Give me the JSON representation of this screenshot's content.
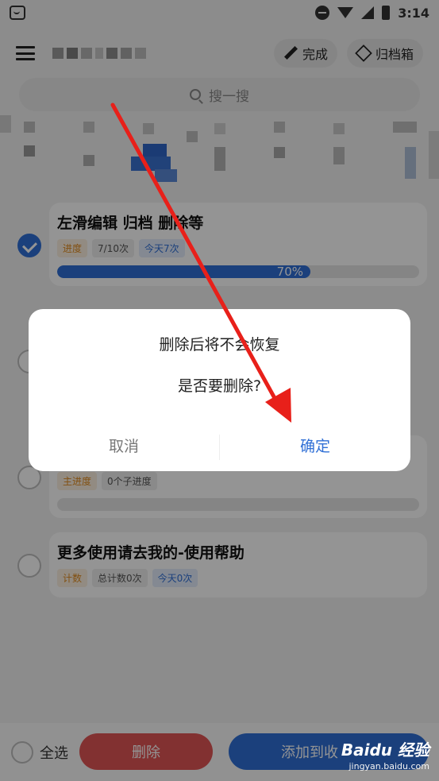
{
  "status_bar": {
    "time": "3:14"
  },
  "header": {
    "done_label": "完成",
    "archive_label": "归档箱"
  },
  "search": {
    "placeholder": "搜一搜"
  },
  "tasks": [
    {
      "title": "左滑编辑 归档 删除等",
      "checked": true,
      "tags": [
        "进度",
        "7/10次",
        "今天7次"
      ],
      "progress_percent": 70,
      "progress_label": "70%"
    },
    {
      "title": "",
      "checked": false,
      "tags": [
        "主进度",
        "0个子进度"
      ],
      "progress_percent": 0
    },
    {
      "title": "更多使用请去我的-使用帮助",
      "checked": false,
      "tags": [
        "计数",
        "总计数0次",
        "今天0次"
      ]
    }
  ],
  "bottom_bar": {
    "select_all_label": "全选",
    "delete_label": "删除",
    "add_label": "添加到收"
  },
  "dialog": {
    "message_line1": "删除后将不会恢复",
    "message_line2": "是否要删除?",
    "cancel_label": "取消",
    "confirm_label": "确定"
  },
  "watermark": {
    "brand": "Baidu 经验",
    "url": "jingyan.baidu.com"
  },
  "colors": {
    "accent_blue": "#2f6fd6",
    "delete_red": "#e05555",
    "tag_orange": "#e08a1e",
    "annotation_arrow": "#e8201a"
  }
}
